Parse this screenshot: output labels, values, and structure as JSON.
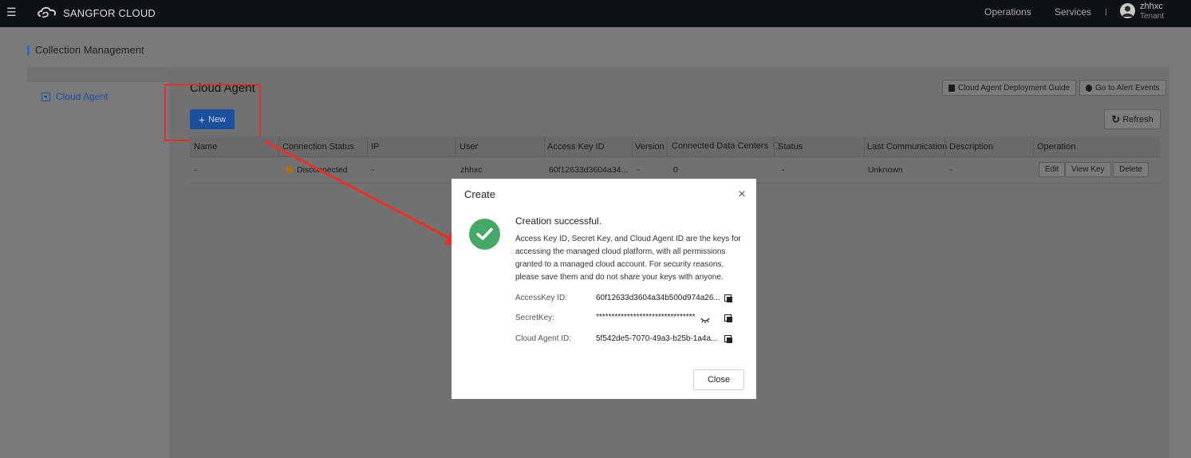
{
  "topbar": {
    "brand": "SANGFOR CLOUD",
    "nav": [
      "Operations",
      "Services"
    ],
    "user_name": "zhhxc",
    "user_role": "Tenant"
  },
  "page": {
    "title": "Collection Management"
  },
  "sidebar": {
    "items": [
      {
        "label": "Cloud Agent"
      }
    ]
  },
  "main": {
    "title": "Cloud Agent",
    "new_label": "New",
    "guide_label": "Cloud Agent Deployment Guide",
    "alert_label": "Go to Alert Events",
    "refresh_label": "Refresh"
  },
  "table": {
    "headers": [
      "Name",
      "Connection Status",
      "IP",
      "User",
      "Access Key ID",
      "Version",
      "Connected Data Centers",
      "Status",
      "Last Communication",
      "Description",
      "Operation"
    ],
    "rows": [
      {
        "name": "-",
        "connection_status": "Disconnected",
        "ip": "-",
        "user": "zhhxc",
        "access_key_id": "60f12633d3604a34...",
        "version": "-",
        "connected_data_centers": "0",
        "status": "-",
        "last_communication": "Unknown",
        "description": "-",
        "actions": [
          "Edit",
          "View Key",
          "Delete"
        ]
      }
    ]
  },
  "modal": {
    "title": "Create",
    "success_title": "Creation successful.",
    "description": "Access Key ID, Secret Key, and Cloud Agent ID are the keys for accessing the managed cloud platform, with all permissions granted to a managed cloud account. For security reasons, please save them and do not share your keys with anyone.",
    "fields": [
      {
        "label": "AccessKey ID:",
        "value": "60f12633d3604a34b500d974a26..."
      },
      {
        "label": "SecretKey:",
        "value": "********************************"
      },
      {
        "label": "Cloud Agent ID:",
        "value": "5f542de5-7070-49a3-b25b-1a4a..."
      }
    ],
    "close_label": "Close"
  },
  "colors": {
    "accent": "#1d4f9f",
    "success": "#45a866",
    "warning": "#b0700f",
    "annotation": "#e8302a"
  }
}
